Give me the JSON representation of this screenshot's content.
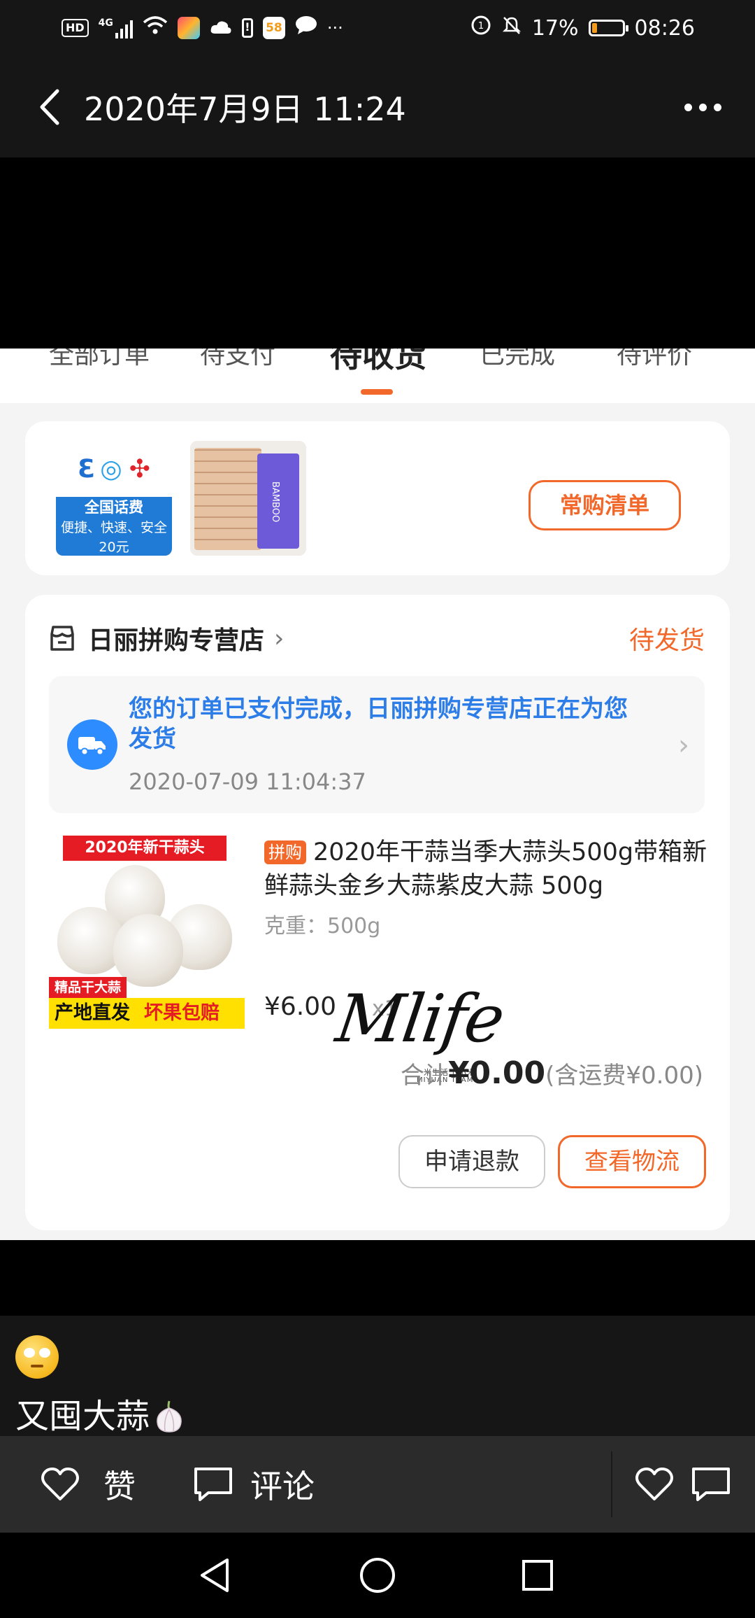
{
  "status_bar": {
    "hd": "HD",
    "signal": "4G",
    "app_badge": "58",
    "dots": "···",
    "battery_percent": "17%",
    "battery_level": 0.17,
    "time": "08:26"
  },
  "header": {
    "title": "2020年7月9日 11:24"
  },
  "order_screenshot": {
    "tabs": [
      {
        "label": "全部订单",
        "active": false
      },
      {
        "label": "待支付",
        "active": false
      },
      {
        "label": "待收货",
        "active": true
      },
      {
        "label": "已完成",
        "active": false
      },
      {
        "label": "待评价",
        "active": false
      }
    ],
    "recommend": {
      "carrier_thumb": {
        "title": "全国话费",
        "subtitle": "便捷、快速、安全",
        "amount": "20元"
      },
      "bamboo_thumb": {
        "brand": "BAMBOO"
      },
      "frequent_list_button": "常购清单"
    },
    "order": {
      "store_name": "日丽拼购专营店",
      "status": "待发货",
      "notice": {
        "message": "您的订单已支付完成，日丽拼购专营店正在为您发货",
        "time": "2020-07-09 11:04:37"
      },
      "product": {
        "image_top_label": "2020年新干蒜头",
        "image_tag": "精品干大蒜",
        "image_bottom_a": "产地直发",
        "image_bottom_b": "坏果包赔",
        "badge": "拼购",
        "title": "2020年干蒜当季大蒜头500g带箱新鲜蒜头金乡大蒜紫皮大蒜 500g",
        "spec": "克重：500g",
        "price": "¥6.00",
        "quantity": "x1"
      },
      "watermark": {
        "main": "Mlife",
        "sub": "米生活 | 小米",
        "team": "MIYUAN TEAM"
      },
      "total": {
        "label": "合计",
        "amount": "¥0.00",
        "shipping": "(含运费¥0.00)"
      },
      "buttons": {
        "refund": "申请退款",
        "logistics": "查看物流"
      }
    }
  },
  "caption": {
    "text": "又囤大蒜"
  },
  "actions": {
    "like_label": "赞",
    "comment_label": "评论"
  },
  "colors": {
    "accent_orange": "#f2682a",
    "notice_blue": "#2d7de8",
    "dark_bar": "#161616"
  }
}
